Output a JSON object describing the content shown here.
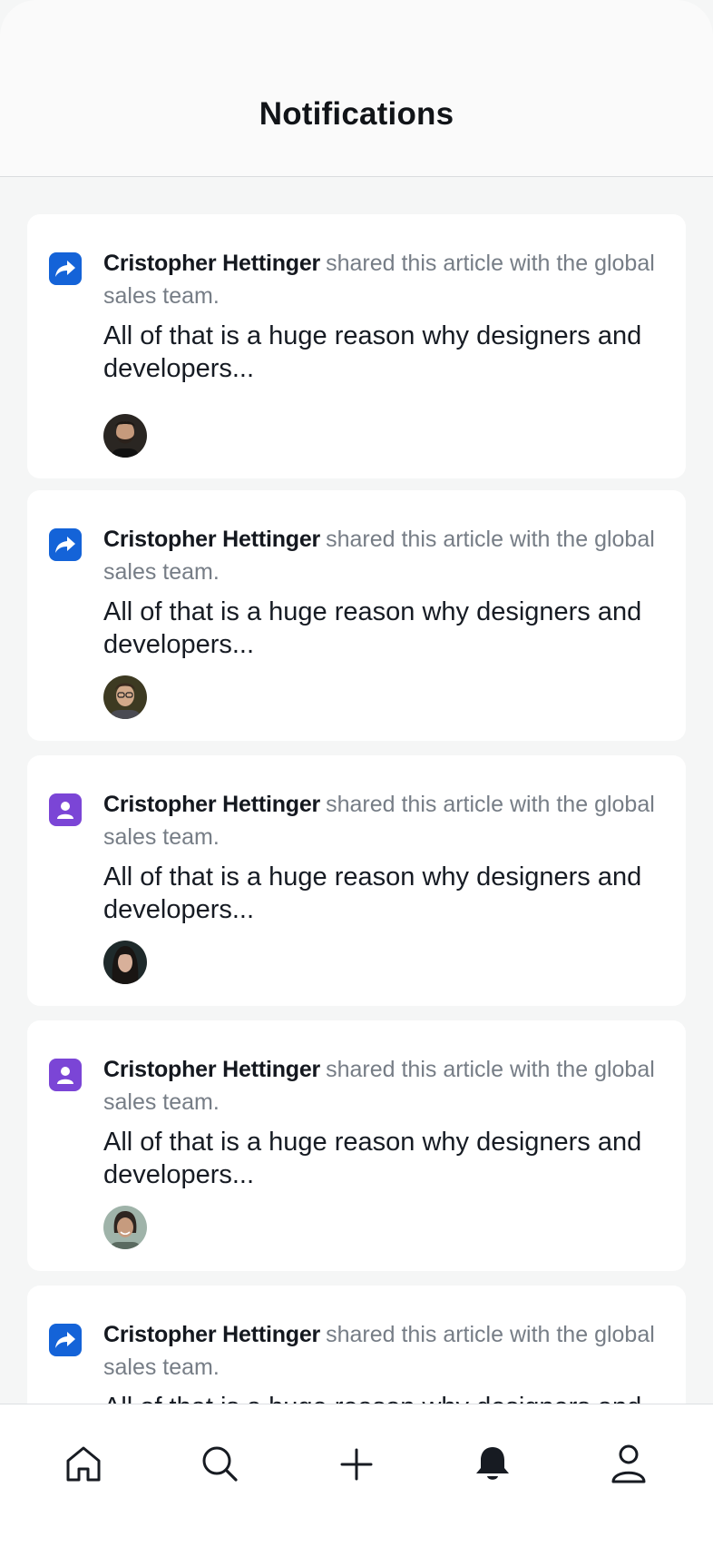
{
  "header": {
    "title": "Notifications"
  },
  "notifications": [
    {
      "type": "share",
      "author": "Cristopher Hettinger",
      "action": "shared this article with the global sales team.",
      "excerpt": "All of that is a huge reason why designers and developers...",
      "avatar": "bearded-man"
    },
    {
      "type": "share",
      "author": "Cristopher Hettinger",
      "action": "shared this article with the global sales team.",
      "excerpt": "All of that is a huge reason why designers and developers...",
      "avatar": "man-glasses"
    },
    {
      "type": "user",
      "author": "Cristopher Hettinger",
      "action": "shared this article with the global sales team.",
      "excerpt": "All of that is a huge reason why designers and developers...",
      "avatar": "woman-dark-hair"
    },
    {
      "type": "user",
      "author": "Cristopher Hettinger",
      "action": "shared this article with the global sales team.",
      "excerpt": "All of that is a huge reason why designers and developers...",
      "avatar": "woman-smiling"
    },
    {
      "type": "share",
      "author": "Cristopher Hettinger",
      "action": "shared this article with the global sales team.",
      "excerpt": "All of that is a huge reason why designers and developers...",
      "avatar": "none"
    }
  ],
  "tabbar": {
    "items": [
      {
        "name": "home",
        "icon": "home-icon",
        "active": false
      },
      {
        "name": "search",
        "icon": "search-icon",
        "active": false
      },
      {
        "name": "create",
        "icon": "plus-icon",
        "active": false
      },
      {
        "name": "notifications",
        "icon": "bell-icon",
        "active": true
      },
      {
        "name": "profile",
        "icon": "user-icon",
        "active": false
      }
    ]
  },
  "colors": {
    "share_badge": "#1463d8",
    "user_badge": "#7b45d6",
    "text_primary": "#161b23",
    "text_secondary": "#767d86",
    "background": "#f5f6f6"
  }
}
